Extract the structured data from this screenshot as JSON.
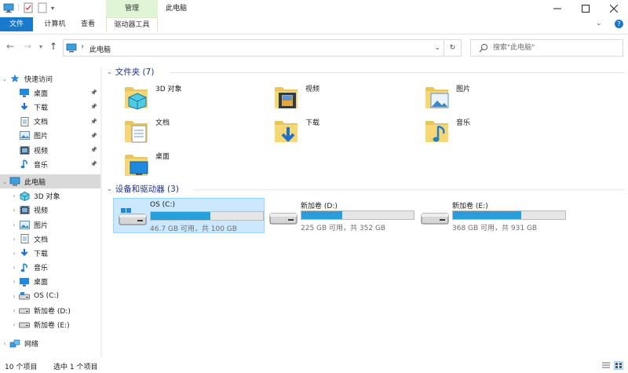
{
  "window": {
    "title": "此电脑",
    "context_tab": "管理"
  },
  "ribbon": {
    "tabs": [
      "文件",
      "计算机",
      "查看"
    ],
    "context_subtab": "驱动器工具",
    "help": "?"
  },
  "address": {
    "path": "此电脑",
    "search_placeholder": "搜索\"此电脑\""
  },
  "nav": {
    "quick_access": {
      "label": "快速访问",
      "items": [
        {
          "label": "桌面",
          "icon": "desktop-icon",
          "pinned": true
        },
        {
          "label": "下载",
          "icon": "download-icon",
          "pinned": true
        },
        {
          "label": "文档",
          "icon": "document-icon",
          "pinned": true
        },
        {
          "label": "图片",
          "icon": "pictures-icon",
          "pinned": true
        },
        {
          "label": "视频",
          "icon": "videos-icon",
          "pinned": true
        },
        {
          "label": "音乐",
          "icon": "music-icon",
          "pinned": true
        }
      ]
    },
    "this_pc": {
      "label": "此电脑",
      "items": [
        {
          "label": "3D 对象",
          "icon": "3d-objects-icon"
        },
        {
          "label": "视频",
          "icon": "videos-icon"
        },
        {
          "label": "图片",
          "icon": "pictures-icon"
        },
        {
          "label": "文档",
          "icon": "document-icon"
        },
        {
          "label": "下载",
          "icon": "download-icon"
        },
        {
          "label": "音乐",
          "icon": "music-icon"
        },
        {
          "label": "桌面",
          "icon": "desktop-icon"
        },
        {
          "label": "OS (C:)",
          "icon": "os-drive-icon"
        },
        {
          "label": "新加卷 (D:)",
          "icon": "drive-icon"
        },
        {
          "label": "新加卷 (E:)",
          "icon": "drive-icon"
        }
      ]
    },
    "network": {
      "label": "网络"
    }
  },
  "main": {
    "folders_header": "文件夹 (7)",
    "folders": [
      {
        "label": "3D 对象",
        "icon": "3d-objects-folder-icon"
      },
      {
        "label": "视频",
        "icon": "videos-folder-icon"
      },
      {
        "label": "图片",
        "icon": "pictures-folder-icon"
      },
      {
        "label": "文档",
        "icon": "documents-folder-icon"
      },
      {
        "label": "下载",
        "icon": "downloads-folder-icon"
      },
      {
        "label": "音乐",
        "icon": "music-folder-icon"
      },
      {
        "label": "桌面",
        "icon": "desktop-folder-icon"
      }
    ],
    "drives_header": "设备和驱动器 (3)",
    "drives": [
      {
        "label": "OS (C:)",
        "free_text": "46.7 GB 可用，共 100 GB",
        "used_fraction": 0.533,
        "selected": true
      },
      {
        "label": "新加卷 (D:)",
        "free_text": "225 GB 可用，共 352 GB",
        "used_fraction": 0.361,
        "selected": false
      },
      {
        "label": "新加卷 (E:)",
        "free_text": "368 GB 可用，共 931 GB",
        "used_fraction": 0.605,
        "selected": false
      }
    ]
  },
  "status": {
    "count": "10 个项目",
    "selected": "选中 1 个项目"
  },
  "colors": {
    "accent": "#1979ca",
    "header_text": "#1e3287",
    "bar_fill": "#26a0da",
    "selection": "#cce8ff",
    "manage_tab": "#dff5d5"
  }
}
